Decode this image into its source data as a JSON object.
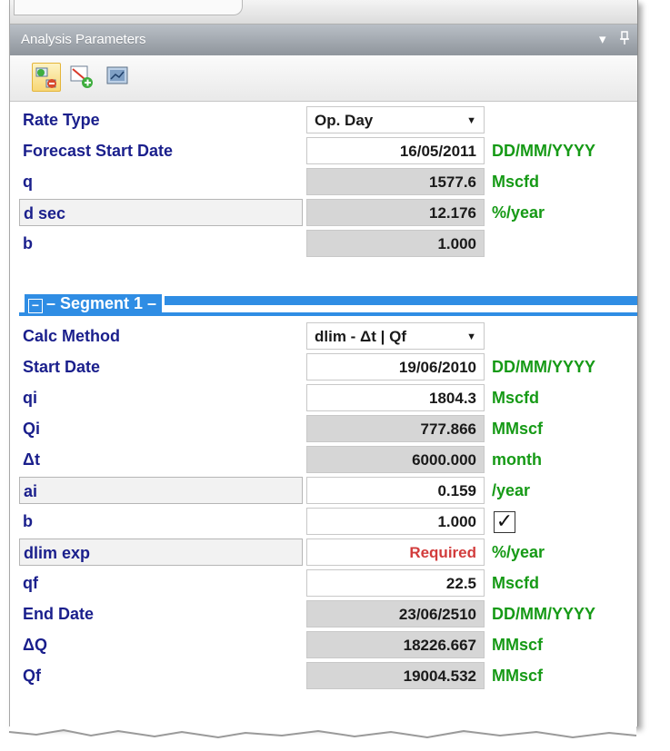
{
  "panel": {
    "title": "Analysis Parameters",
    "pin_glyph": "▾ ⊞",
    "toolbar_icons": [
      "add-remove-segment-icon",
      "add-segment-icon",
      "chart-view-icon"
    ]
  },
  "params": [
    {
      "label": "Rate Type",
      "type": "dropdown",
      "value": "Op. Day",
      "unit": ""
    },
    {
      "label": "Forecast Start Date",
      "type": "rw",
      "value": "16/05/2011",
      "unit": "DD/MM/YYYY"
    },
    {
      "label": "q",
      "type": "ro",
      "value": "1577.6",
      "unit": "Mscfd"
    },
    {
      "label": "d sec",
      "type": "ro",
      "value": "12.176",
      "unit": "%/year"
    },
    {
      "label": "b",
      "type": "ro",
      "value": "1.000",
      "unit": ""
    }
  ],
  "segment": {
    "toggle": "⊟",
    "title": "– Segment 1 –"
  },
  "seg_params": [
    {
      "label": "Calc Method",
      "type": "dropdown",
      "value": "dlim - Δt | Qf",
      "unit": ""
    },
    {
      "label": "Start Date",
      "type": "rw",
      "value": "19/06/2010",
      "unit": "DD/MM/YYYY"
    },
    {
      "label": "qi",
      "type": "rw",
      "value": "1804.3",
      "unit": "Mscfd"
    },
    {
      "label": "Qi",
      "type": "ro",
      "value": "777.866",
      "unit": "MMscf"
    },
    {
      "label": "Δt",
      "type": "ro",
      "value": "6000.000",
      "unit": "month"
    },
    {
      "label": "ai",
      "type": "rw",
      "value": "0.159",
      "unit": "/year"
    },
    {
      "label": "b",
      "type": "rw",
      "value": "1.000",
      "unit": "checkbox"
    },
    {
      "label": "dlim exp",
      "type": "req",
      "value": "Required",
      "unit": "%/year"
    },
    {
      "label": "qf",
      "type": "rw",
      "value": "22.5",
      "unit": "Mscfd"
    },
    {
      "label": "End Date",
      "type": "ro",
      "value": "23/06/2510",
      "unit": "DD/MM/YYYY"
    },
    {
      "label": "ΔQ",
      "type": "ro",
      "value": "18226.667",
      "unit": "MMscf"
    },
    {
      "label": "Qf",
      "type": "ro",
      "value": "19004.532",
      "unit": "MMscf"
    }
  ],
  "colors": {
    "label": "#1a1f8c",
    "unit": "#169a16",
    "segment_bar": "#2f8de4",
    "required": "#d23c3c"
  }
}
